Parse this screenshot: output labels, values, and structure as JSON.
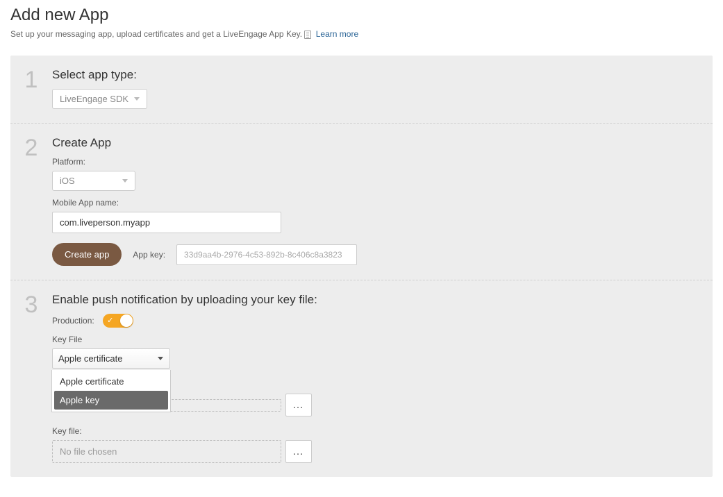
{
  "header": {
    "title": "Add new App",
    "subtitle": "Set up your messaging app, upload certificates and get a LiveEngage App Key.",
    "learn_more": "Learn more"
  },
  "step1": {
    "num": "1",
    "title": "Select app type:",
    "sdk_value": "LiveEngage SDK"
  },
  "step2": {
    "num": "2",
    "title": "Create App",
    "platform_label": "Platform:",
    "platform_value": "iOS",
    "appname_label": "Mobile App name:",
    "appname_value": "com.liveperson.myapp",
    "create_btn": "Create app",
    "appkey_label": "App key:",
    "appkey_value": "33d9aa4b-2976-4c53-892b-8c406c8a3823"
  },
  "step3": {
    "num": "3",
    "title": "Enable push notification by uploading your key file:",
    "production_label": "Production:",
    "keyfile_label": "Key File",
    "keyfile_selected": "Apple certificate",
    "keyfile_options": [
      "Apple certificate",
      "Apple key"
    ],
    "keyfile_highlighted_index": 1,
    "file1_placeholder": "",
    "file2_label": "Key file:",
    "file2_placeholder": "No file chosen",
    "browse_label": "…"
  }
}
